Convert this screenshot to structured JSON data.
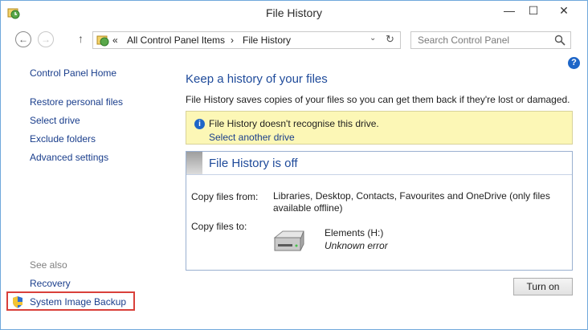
{
  "window": {
    "title": "File History"
  },
  "titlebar": {
    "minimize": "—",
    "maximize": "☐",
    "close": "✕"
  },
  "address": {
    "overflow": "«",
    "crumbs": [
      "All Control Panel Items",
      "File History"
    ],
    "separator": "›"
  },
  "search": {
    "placeholder": "Search Control Panel"
  },
  "sidebar": {
    "home": "Control Panel Home",
    "items": [
      "Restore personal files",
      "Select drive",
      "Exclude folders",
      "Advanced settings"
    ],
    "see_also": "See also",
    "see_also_items": [
      "Recovery",
      "System Image Backup"
    ]
  },
  "main": {
    "heading": "Keep a history of your files",
    "intro": "File History saves copies of your files so you can get them back if they're lost or damaged.",
    "info": {
      "message": "File History doesn't recognise this drive.",
      "link": "Select another drive"
    },
    "panel": {
      "title": "File History is off",
      "copy_from_label": "Copy files from:",
      "copy_from_value_1": "Libraries, Desktop, Contacts, Favourites and OneDrive (only files",
      "copy_from_value_2": "available offline)",
      "copy_to_label": "Copy files to:",
      "drive_name": "Elements (H:)",
      "drive_status": "Unknown error"
    },
    "turn_on_button": "Turn on"
  },
  "colors": {
    "link": "#1a3e8c",
    "heading": "#1e4a9a",
    "info_bg": "#fcf7b6",
    "highlight": "#d9403a"
  },
  "icons": [
    "file-history-app-icon",
    "back-arrow-icon",
    "forward-arrow-icon",
    "up-arrow-icon",
    "refresh-icon",
    "search-icon",
    "help-icon",
    "info-icon",
    "drive-icon",
    "shield-icon"
  ]
}
